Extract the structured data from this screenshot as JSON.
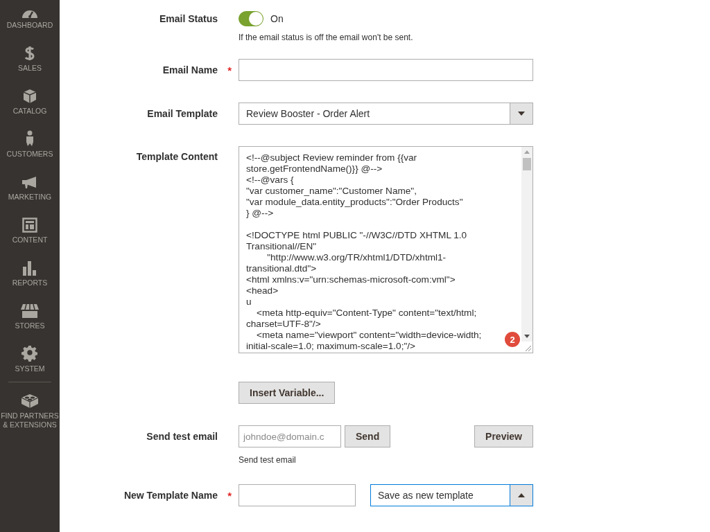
{
  "sidebar": {
    "items": [
      {
        "kind": "dashboard",
        "label": "DASHBOARD"
      },
      {
        "kind": "sales",
        "label": "SALES"
      },
      {
        "kind": "catalog",
        "label": "CATALOG"
      },
      {
        "kind": "customers",
        "label": "CUSTOMERS"
      },
      {
        "kind": "marketing",
        "label": "MARKETING"
      },
      {
        "kind": "content",
        "label": "CONTENT"
      },
      {
        "kind": "reports",
        "label": "REPORTS"
      },
      {
        "kind": "stores",
        "label": "STORES"
      },
      {
        "kind": "system",
        "label": "SYSTEM"
      },
      {
        "kind": "partners",
        "label": "FIND PARTNERS & EXTENSIONS"
      }
    ]
  },
  "form": {
    "email_status": {
      "label": "Email Status",
      "on": true,
      "state_text": "On",
      "note": "If the email status is off the email won't be sent."
    },
    "email_name": {
      "label": "Email Name",
      "required_mark": "*"
    },
    "email_template": {
      "label": "Email Template",
      "value": "Review Booster - Order Alert",
      "expanded": false
    },
    "template_content": {
      "label": "Template Content",
      "badge": "2",
      "blocks": [
        [
          "<!--@subject Review reminder from {{var",
          "store.getFrontendName()}} @-->",
          "<!--@vars {",
          "\"var customer_name\":\"Customer Name\",",
          "\"var module_data.entity_products\":\"Order Products\"",
          "} @-->"
        ],
        [
          "<!DOCTYPE html PUBLIC \"-//W3C//DTD XHTML 1.0",
          "Transitional//EN\"",
          "        \"http://www.w3.org/TR/xhtml1/DTD/xhtml1-",
          "transitional.dtd\">",
          "<html xmlns:v=\"urn:schemas-microsoft-com:vml\">",
          "<head>",
          "u",
          "    <meta http-equiv=\"Content-Type\" content=\"text/html;",
          "charset=UTF-8\"/>",
          "    <meta name=\"viewport\" content=\"width=device-width;",
          "initial-scale=1.0; maximum-scale=1.0;\"/>"
        ]
      ]
    },
    "insert_variable_button": "Insert Variable...",
    "send_test": {
      "label": "Send test email",
      "placeholder": "johndoe@domain.c",
      "send_button": "Send",
      "preview_button": "Preview",
      "note": "Send test email"
    },
    "new_template": {
      "label": "New Template Name",
      "required_mark": "*",
      "save_option": "Save as new template",
      "expanded": true
    }
  }
}
